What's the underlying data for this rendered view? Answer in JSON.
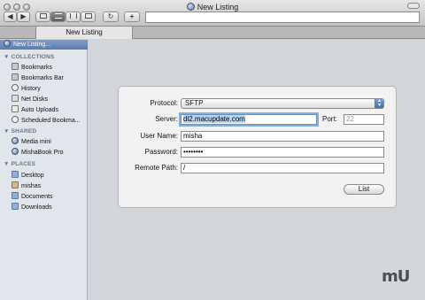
{
  "window": {
    "title": "New Listing"
  },
  "toolbar": {
    "back": "◀",
    "forward": "▶",
    "refresh": "↻",
    "add": "+"
  },
  "tab": {
    "label": "New Listing"
  },
  "sidebar": {
    "selected": "New Listing...",
    "collections_header": "COLLECTIONS",
    "collections": [
      "Bookmarks",
      "Bookmarks Bar",
      "History",
      "Net Disks",
      "Auto Uploads",
      "Scheduled Bookma..."
    ],
    "shared_header": "SHARED",
    "shared": [
      "Media mini",
      "MishaBook Pro"
    ],
    "places_header": "PLACES",
    "places": [
      "Desktop",
      "mishas",
      "Documents",
      "Downloads"
    ]
  },
  "form": {
    "protocol_label": "Protocol:",
    "protocol_value": "SFTP",
    "server_label": "Server:",
    "server_value": "dl2.macupdate.com",
    "port_label": "Port:",
    "port_placeholder": "22",
    "username_label": "User Name:",
    "username_value": "misha",
    "password_label": "Password:",
    "password_value": "••••••••",
    "remotepath_label": "Remote Path:",
    "remotepath_value": "/",
    "list_button": "List"
  },
  "watermark": "mU"
}
